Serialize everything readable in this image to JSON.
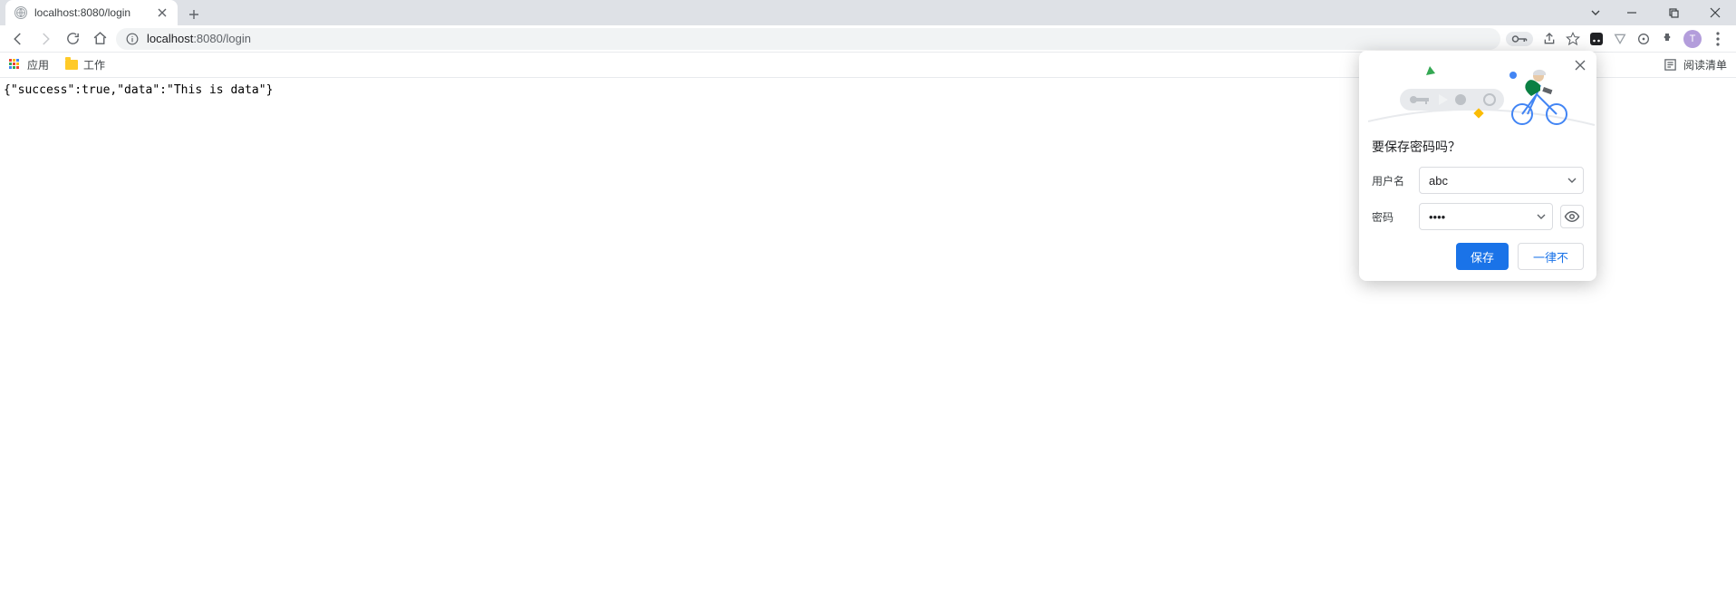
{
  "tab": {
    "title": "localhost:8080/login"
  },
  "address": {
    "host": "localhost",
    "port": ":8080",
    "path": "/login"
  },
  "bookmarks": {
    "apps": "应用",
    "work": "工作",
    "reading_list": "阅读清单"
  },
  "avatar_initial": "T",
  "page_content": "{\"success\":true,\"data\":\"This is data\"}",
  "save_pw": {
    "title": "要保存密码吗？",
    "user_label": "用户名",
    "user_value": "abc",
    "pwd_label": "密码",
    "pwd_value": "••••",
    "save": "保存",
    "never": "一律不"
  }
}
